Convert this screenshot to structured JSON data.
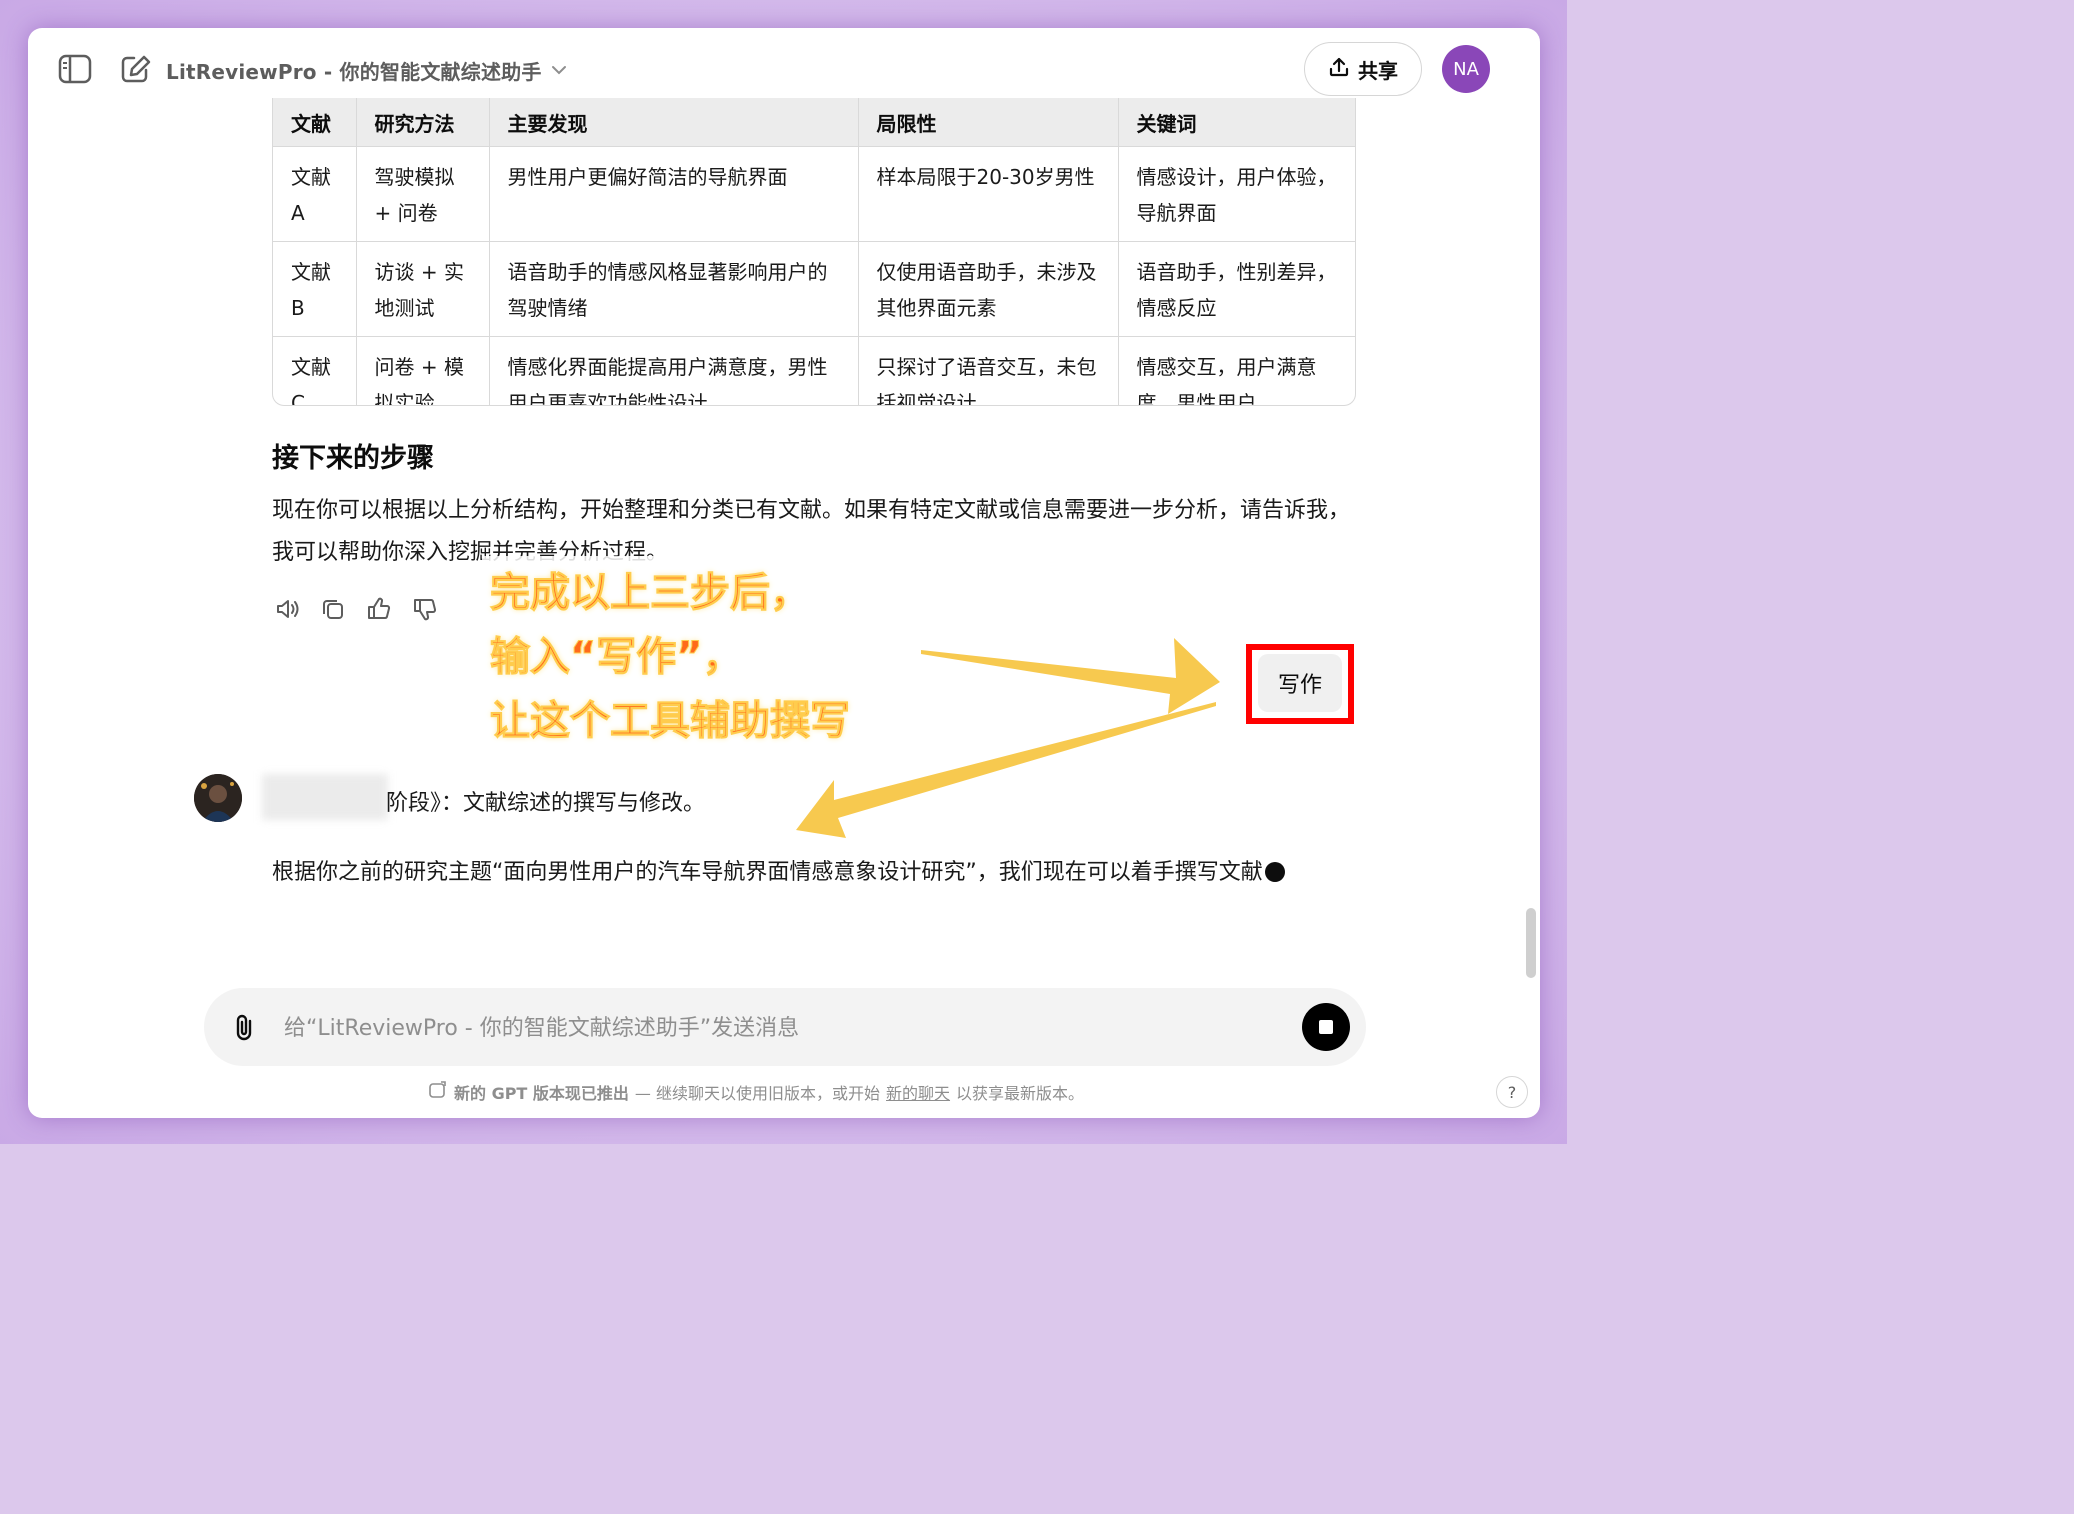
{
  "header": {
    "title": "LitReviewPro - 你的智能文献综述助手",
    "share_label": "共享",
    "avatar_initials": "NA"
  },
  "table": {
    "headers": [
      "文献",
      "研究方法",
      "主要发现",
      "局限性",
      "关键词"
    ],
    "rows": [
      [
        "文献A",
        "驾驶模拟 + 问卷",
        "男性用户更偏好简洁的导航界面",
        "样本局限于20-30岁男性",
        "情感设计，用户体验，导航界面"
      ],
      [
        "文献B",
        "访谈 + 实地测试",
        "语音助手的情感风格显著影响用户的驾驶情绪",
        "仅使用语音助手，未涉及其他界面元素",
        "语音助手，性别差异，情感反应"
      ],
      [
        "文献C",
        "问卷 + 模拟实验",
        "情感化界面能提高用户满意度，男性用户更喜欢功能性设计",
        "只探讨了语音交互，未包括视觉设计",
        "情感交互，用户满意度，男性用户"
      ]
    ]
  },
  "next_steps": {
    "heading": "接下来的步骤",
    "body": "现在你可以根据以上分析结构，开始整理和分类已有文献。如果有特定文献或信息需要进一步分析，请告诉我，我可以帮助你深入挖掘并完善分析过程。"
  },
  "annotation": {
    "line1": "完成以上三步后，",
    "line2": "输入“写作”，",
    "line3": "让这个工具辅助撰写",
    "accent_color": "#ff6a1a",
    "arrow_color": "#f7c94f",
    "box_color": "#ff0000"
  },
  "write_button_label": "写作",
  "user_message": "阶段》：文献综述的撰写与修改。",
  "assistant_reply": "根据你之前的研究主题“面向男性用户的汽车导航界面情感意象设计研究”，我们现在可以着手撰写文献",
  "composer": {
    "placeholder": "给“LitReviewPro - 你的智能文献综述助手”发送消息"
  },
  "footer": {
    "notice_bold": "新的 GPT 版本现已推出",
    "notice_mid": " — 继续聊天以使用旧版本，或开始",
    "link": "新的聊天",
    "notice_end": "以获享最新版本。",
    "help": "?"
  }
}
